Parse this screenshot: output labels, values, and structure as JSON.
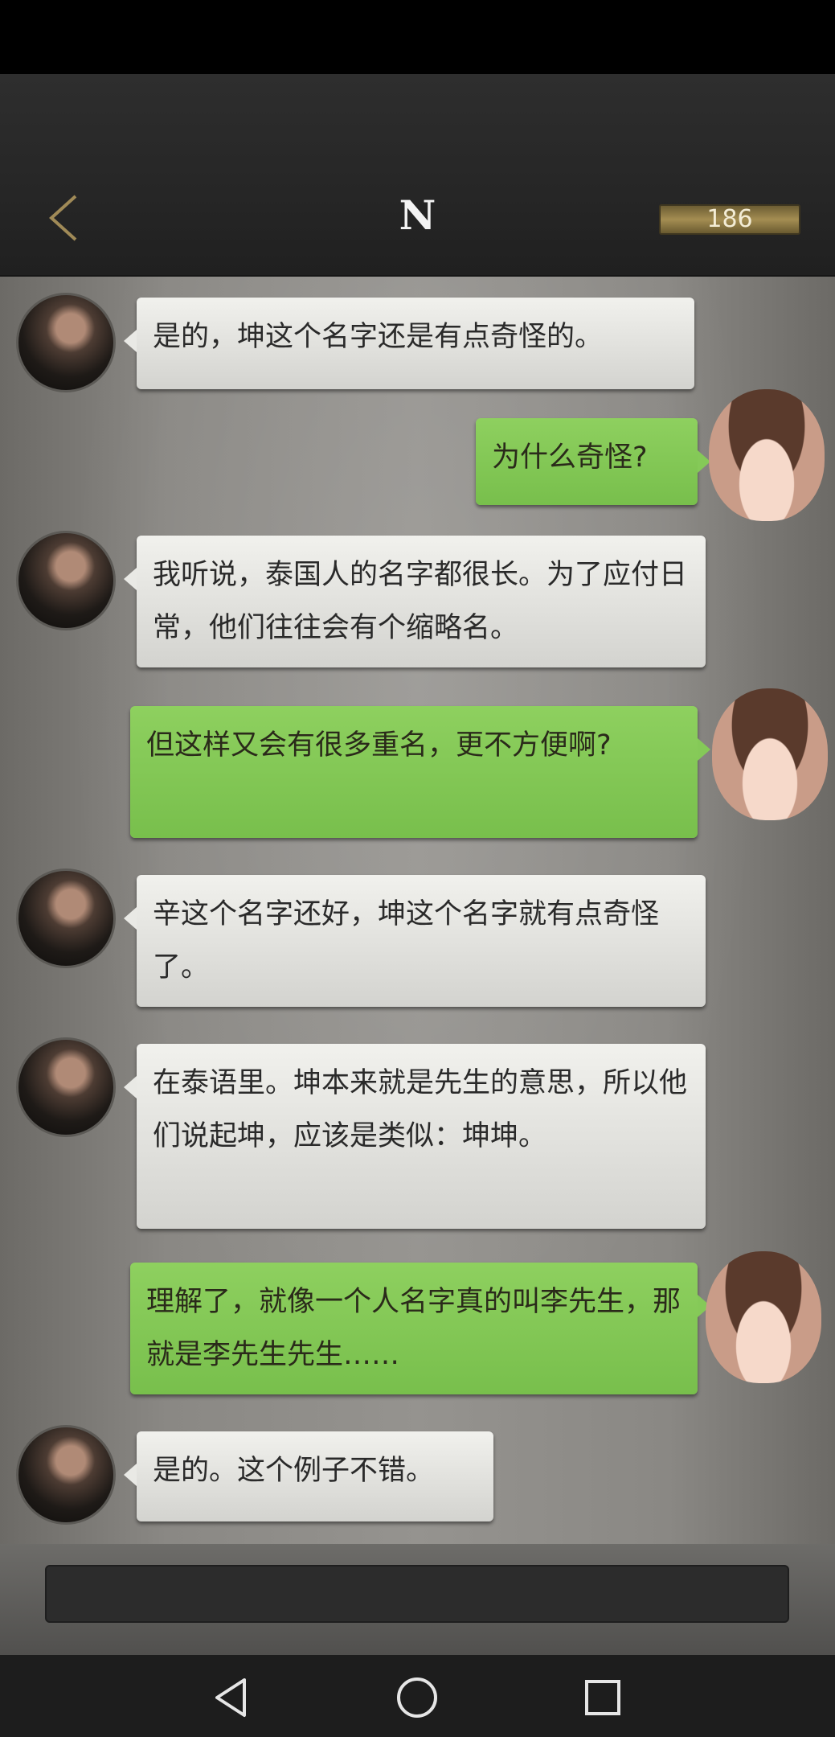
{
  "header": {
    "title": "N",
    "score": "186"
  },
  "messages": [
    {
      "side": "left",
      "text": "是的，坤这个名字还是有点奇怪的。"
    },
    {
      "side": "right",
      "text": "为什么奇怪?"
    },
    {
      "side": "left",
      "text": "我听说，泰国人的名字都很长。为了应付日常，他们往往会有个缩略名。"
    },
    {
      "side": "right",
      "text": "但这样又会有很多重名，更不方便啊?"
    },
    {
      "side": "left",
      "text": "辛这个名字还好，坤这个名字就有点奇怪了。"
    },
    {
      "side": "left",
      "text": "在泰语里。坤本来就是先生的意思，所以他们说起坤，应该是类似：坤坤。"
    },
    {
      "side": "right",
      "text": "理解了，就像一个人名字真的叫李先生，那就是李先生先生……"
    },
    {
      "side": "left",
      "text": "是的。这个例子不错。"
    }
  ],
  "input": {
    "placeholder": ""
  },
  "icons": {
    "back": "chevron-left-icon",
    "nav_back": "triangle-back-icon",
    "nav_home": "circle-home-icon",
    "nav_recents": "square-recents-icon"
  },
  "colors": {
    "header_bg": "#2a2a2a",
    "bubble_green": "#85c958",
    "bubble_gray": "#e9e9e5",
    "back_arrow": "#a08a57",
    "score_bar": "#a48d52"
  }
}
